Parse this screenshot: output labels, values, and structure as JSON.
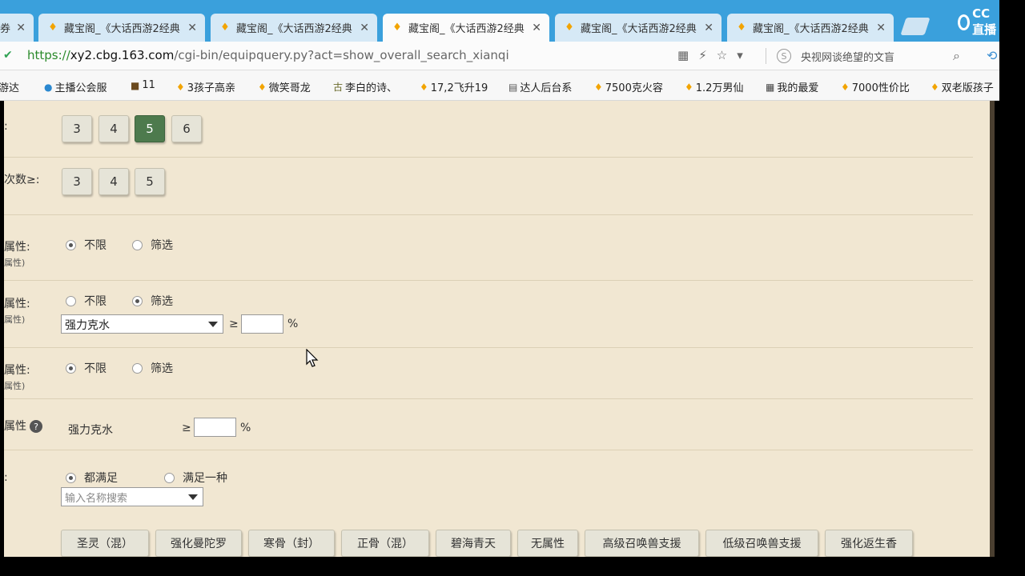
{
  "browser": {
    "tabs": [
      {
        "label": "",
        "partial": "券",
        "active": false
      },
      {
        "label": "藏宝阁_《大话西游2经典"
      },
      {
        "label": "藏宝阁_《大话西游2经典"
      },
      {
        "label": "藏宝阁_《大话西游2经典",
        "active": true
      },
      {
        "label": "藏宝阁_《大话西游2经典"
      },
      {
        "label": "藏宝阁_《大话西游2经典"
      }
    ],
    "close_glyph": "✕",
    "overlay_logo": "CC直播",
    "url": {
      "proto": "https://",
      "host": "xy2.cbg.163.com",
      "path": "/cgi-bin/equipquery.py?act=show_overall_search_xianqi"
    },
    "search_hint": "央视网谈绝望的文盲",
    "bookmarks": [
      "游达",
      "主播公会服",
      "11",
      "3孩子高亲",
      "微笑哥龙",
      "李白的诗、",
      "17,2飞升19",
      "达人后台系",
      "7500克火容",
      "1.2万男仙",
      "我的最爱",
      "7000性价比",
      "双老版孩子"
    ]
  },
  "form": {
    "row1": {
      "label": ":",
      "buttons": [
        "3",
        "4",
        "5",
        "6"
      ],
      "selected": "5"
    },
    "row2": {
      "label": "次数≥:",
      "buttons": [
        "3",
        "4",
        "5"
      ]
    },
    "row3": {
      "label": "属性:",
      "sub": "属性)",
      "opt_unlimited": "不限",
      "opt_filter": "筛选",
      "selected": "unlimited"
    },
    "row4": {
      "label": "属性:",
      "sub": "属性)",
      "opt_unlimited": "不限",
      "opt_filter": "筛选",
      "selected": "filter",
      "select_value": "强力克水",
      "ge": "≥",
      "pct": "%"
    },
    "row5": {
      "label": "属性:",
      "sub": "属性)",
      "opt_unlimited": "不限",
      "opt_filter": "筛选",
      "selected": "unlimited"
    },
    "row6": {
      "label": "属性",
      "help": "?",
      "attr": "强力克水",
      "ge": "≥",
      "pct": "%"
    },
    "row7": {
      "label": ":",
      "opt_all": "都满足",
      "opt_any": "满足一种",
      "selected": "all",
      "search_placeholder": "输入名称搜索"
    },
    "tags": [
      "圣灵（混）",
      "强化曼陀罗",
      "寒骨（封）",
      "正骨（混）",
      "碧海青天",
      "无属性",
      "高级召唤兽支援",
      "低级召唤兽支援",
      "强化返生香"
    ]
  }
}
